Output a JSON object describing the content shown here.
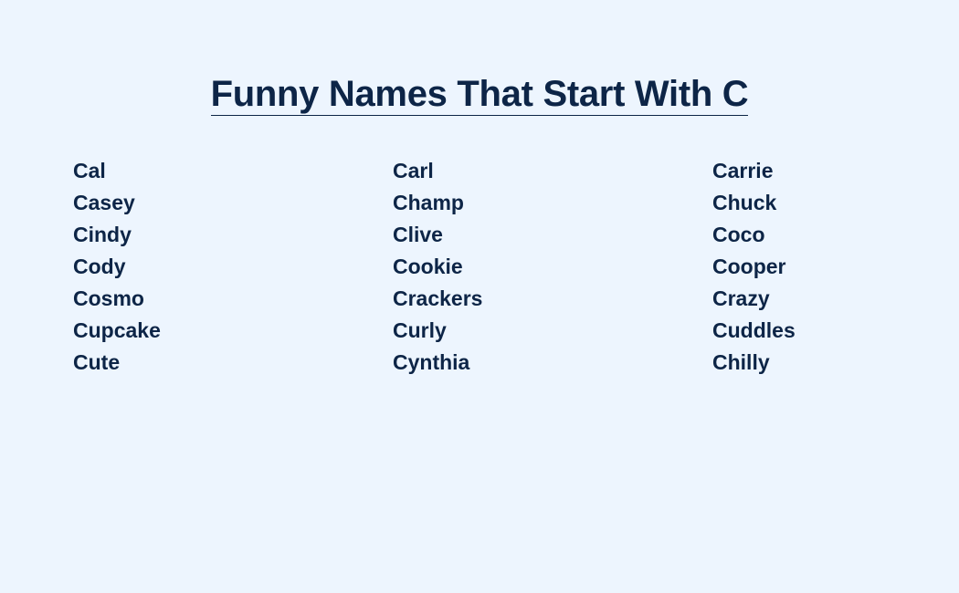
{
  "page": {
    "title": "Funny Names That Start With C"
  },
  "columns": [
    {
      "names": [
        "Cal",
        "Casey",
        "Cindy",
        "Cody",
        "Cosmo",
        "Cupcake",
        "Cute"
      ]
    },
    {
      "names": [
        "Carl",
        "Champ",
        "Clive",
        "Cookie",
        "Crackers",
        "Curly",
        "Cynthia"
      ]
    },
    {
      "names": [
        "Carrie",
        "Chuck",
        "Coco",
        "Cooper",
        "Crazy",
        "Cuddles",
        "Chilly"
      ]
    }
  ],
  "colors": {
    "background": "#edf5fe",
    "text": "#0d2547"
  }
}
